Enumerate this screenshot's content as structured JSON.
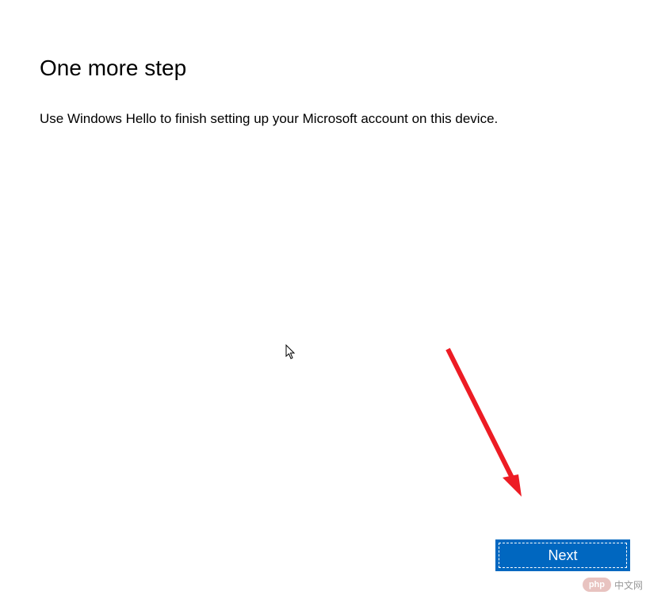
{
  "dialog": {
    "title": "One more step",
    "description": "Use Windows Hello to finish setting up your Microsoft account on this device.",
    "next_button_label": "Next"
  },
  "annotation": {
    "arrow_color": "#ed1c24"
  },
  "watermark": {
    "badge_text": "php",
    "label_text": "中文网"
  }
}
